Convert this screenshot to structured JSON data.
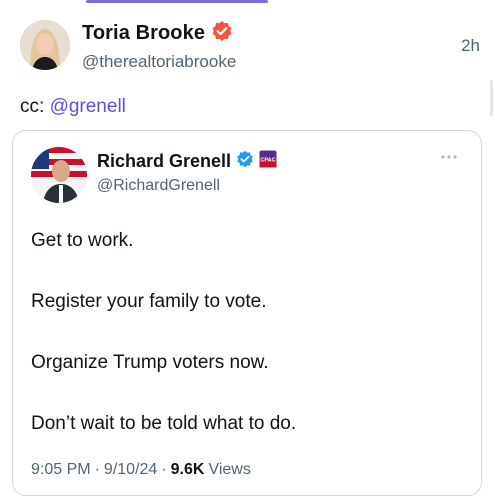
{
  "colors": {
    "accent": "#5b51d8",
    "verified_badge": "#f0553d",
    "verified_blue": "#1d9bf0",
    "secondary_text": "#536471",
    "border": "#cfd9de"
  },
  "post": {
    "author": {
      "name": "Toria Brooke",
      "handle": "@therealtoriabrooke",
      "verified_icon": "verified-badge-icon"
    },
    "timestamp": "2h",
    "text_prefix": "cc: ",
    "mention": "@grenell"
  },
  "quoted_post": {
    "author": {
      "name": "Richard Grenell",
      "handle": "@RichardGrenell",
      "verified_icon": "verified-badge-icon",
      "affiliate_icon": "affiliate-badge-icon",
      "affiliate_badge_text": "CPAC"
    },
    "more_icon": "more-options-icon",
    "lines": [
      "Get to work.",
      "Register your family to vote.",
      "Organize Trump voters now.",
      "Don’t wait to be told what to do."
    ],
    "meta": {
      "time": "9:05 PM",
      "separator": "·",
      "date": "9/10/24",
      "views_count": "9.6K",
      "views_label": "Views"
    }
  }
}
